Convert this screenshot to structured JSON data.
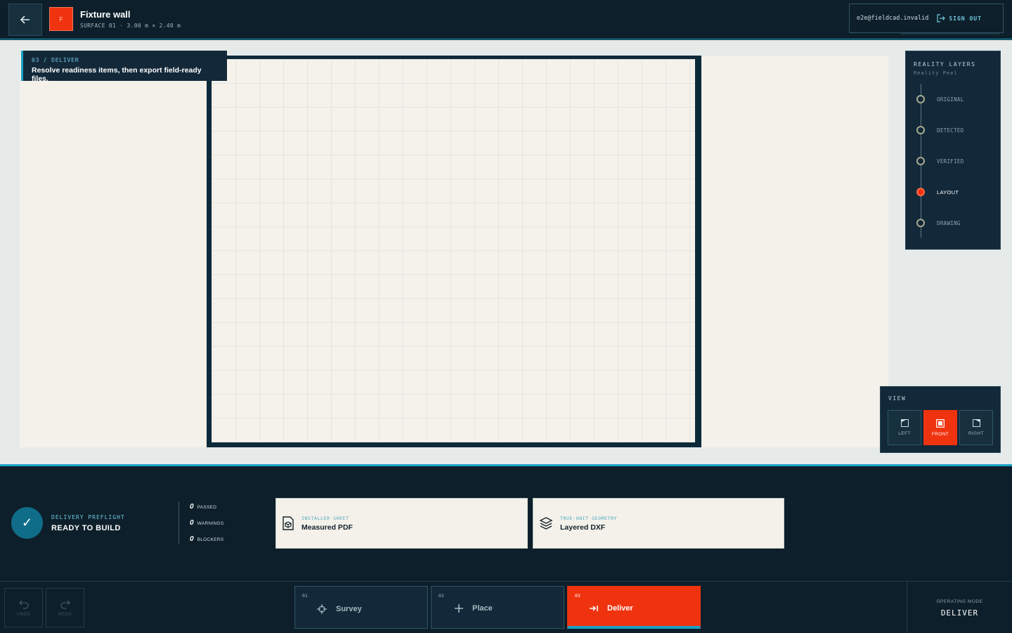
{
  "header": {
    "logo_letter": "F",
    "title": "Fixture wall",
    "subtitle": "SURFACE 01 · 3.00 m × 2.40 m",
    "user_email": "e2e@fieldcad.invalid",
    "sign_out_label": "SIGN OUT",
    "back_icon": "arrow-left-icon"
  },
  "workspace": {
    "step_label": "03 / DELIVER",
    "step_text": "Resolve readiness items, then export field-ready files."
  },
  "layers": {
    "title": "REALITY LAYERS",
    "subtitle": "Reality Peel",
    "items": [
      {
        "label": "ORIGINAL",
        "active": false
      },
      {
        "label": "DETECTED",
        "active": false
      },
      {
        "label": "VERIFIED",
        "active": false
      },
      {
        "label": "LAYOUT",
        "active": true
      },
      {
        "label": "DRAWING",
        "active": false
      }
    ]
  },
  "view": {
    "title": "VIEW",
    "buttons": [
      {
        "label": "LEFT",
        "active": false,
        "icon": "view-left-icon"
      },
      {
        "label": "FRONT",
        "active": true,
        "icon": "view-front-icon"
      },
      {
        "label": "RIGHT",
        "active": false,
        "icon": "view-right-icon"
      }
    ]
  },
  "delivery": {
    "preflight_label": "DELIVERY PREFLIGHT",
    "preflight_status": "READY TO BUILD",
    "counts": [
      {
        "value": "0",
        "label": "PASSED"
      },
      {
        "value": "0",
        "label": "WARNINGS"
      },
      {
        "value": "0",
        "label": "BLOCKERS"
      }
    ],
    "exports": [
      {
        "kicker": "INSTALLER SHEET",
        "title": "Measured PDF",
        "icon": "pdf-cube-icon"
      },
      {
        "kicker": "TRUE-UNIT GEOMETRY",
        "title": "Layered DXF",
        "icon": "layers-icon"
      }
    ]
  },
  "footer": {
    "undo_label": "UNDO",
    "redo_label": "REDO",
    "steps": [
      {
        "num": "01",
        "label": "Survey",
        "icon": "crosshair-icon",
        "active": false
      },
      {
        "num": "02",
        "label": "Place",
        "icon": "plus-icon",
        "active": false
      },
      {
        "num": "03",
        "label": "Deliver",
        "icon": "export-icon",
        "active": true
      }
    ],
    "mode_label": "OPERATING MODE",
    "mode_value": "DELIVER"
  },
  "colors": {
    "accent": "#f0330f",
    "cyan": "#1aa0c4",
    "panel": "#13293a",
    "background": "#0d1f2a"
  }
}
